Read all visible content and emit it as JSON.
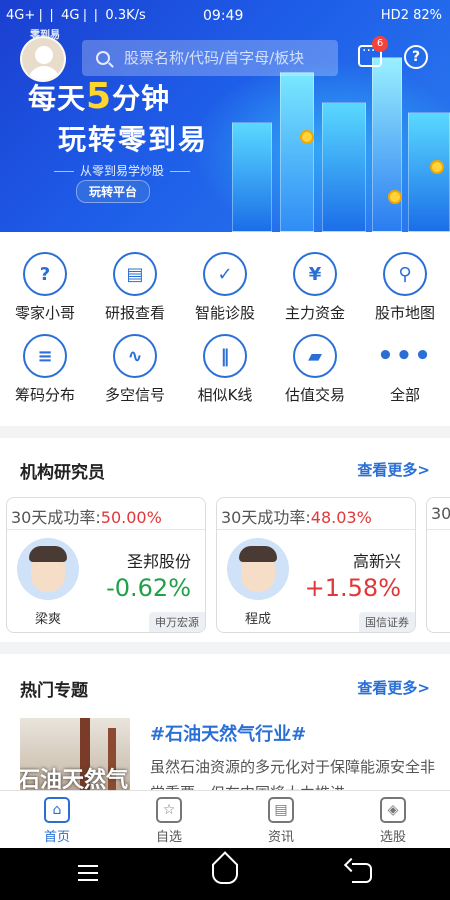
{
  "status_bar": {
    "left": "4G+❘❘ 4G❘❘ 0.3K/s",
    "time": "09:49",
    "right": "HD2 82%"
  },
  "banner": {
    "logo_text": "零到易",
    "line1_pre": "每天",
    "line1_highlight": "5",
    "line1_post": "分钟",
    "line2": "玩转零到易",
    "line3": "从零到易学炒股",
    "button": "玩转平台"
  },
  "search": {
    "placeholder": "股票名称/代码/首字母/板块"
  },
  "header": {
    "message_badge": "6"
  },
  "grid": [
    {
      "label": "零家小哥",
      "icon": "question-bubble-icon",
      "glyph": "?"
    },
    {
      "label": "研报查看",
      "icon": "report-book-icon",
      "glyph": "▤"
    },
    {
      "label": "智能诊股",
      "icon": "shield-check-icon",
      "glyph": "✓"
    },
    {
      "label": "主力资金",
      "icon": "yen-icon",
      "glyph": "¥"
    },
    {
      "label": "股市地图",
      "icon": "map-pin-icon",
      "glyph": "⚲"
    },
    {
      "label": "筹码分布",
      "icon": "chip-bars-icon",
      "glyph": "≡"
    },
    {
      "label": "多空信号",
      "icon": "signal-wave-icon",
      "glyph": "∿"
    },
    {
      "label": "相似K线",
      "icon": "candlestick-icon",
      "glyph": "‖"
    },
    {
      "label": "估值交易",
      "icon": "gold-bar-icon",
      "glyph": "▰"
    },
    {
      "label": "全部",
      "icon": "more-dots-icon",
      "glyph": "•••"
    }
  ],
  "researchers": {
    "title": "机构研究员",
    "more": "查看更多>",
    "cards": [
      {
        "rate_label": "30天成功率:",
        "rate_value": "50.00%",
        "name": "梁爽",
        "stock": "圣邦股份",
        "change": "-0.62%",
        "direction": "down",
        "org": "申万宏源"
      },
      {
        "rate_label": "30天成功率:",
        "rate_value": "48.03%",
        "name": "程成",
        "stock": "高新兴",
        "change": "+1.58%",
        "direction": "up",
        "org": "国信证券"
      },
      {
        "rate_label": "30"
      }
    ]
  },
  "topics": {
    "title": "热门专题",
    "more": "查看更多>",
    "item": {
      "image_text": "石油天然气",
      "title": "#石油天然气行业#",
      "desc": "虽然石油资源的多元化对于保障能源安全非常重要，但在中国将大力推进"
    }
  },
  "tabbar": [
    {
      "label": "首页",
      "icon": "home-icon",
      "glyph": "⌂",
      "active": true
    },
    {
      "label": "自选",
      "icon": "star-icon",
      "glyph": "☆",
      "active": false
    },
    {
      "label": "资讯",
      "icon": "news-icon",
      "glyph": "▤",
      "active": false
    },
    {
      "label": "选股",
      "icon": "compass-icon",
      "glyph": "◈",
      "active": false
    }
  ],
  "colors": {
    "accent": "#2a6fd6",
    "up": "#e0383a",
    "down": "#21a04a",
    "banner": "#1e5de8"
  }
}
